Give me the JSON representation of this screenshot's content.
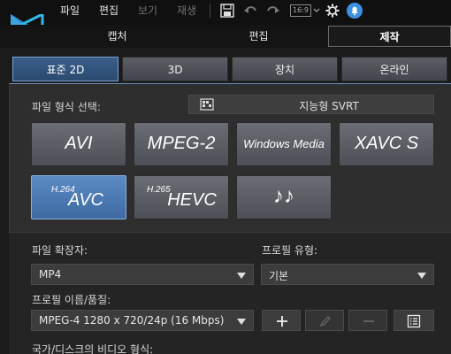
{
  "menu": {
    "items": [
      {
        "label": "파일",
        "enabled": true
      },
      {
        "label": "편집",
        "enabled": true
      },
      {
        "label": "보기",
        "enabled": false
      },
      {
        "label": "재생",
        "enabled": false
      }
    ],
    "aspect_label": "16:9",
    "icons": [
      "save-icon",
      "undo-icon",
      "redo-icon",
      "aspect-ratio-icon",
      "settings-gear-icon",
      "notification-bell-icon"
    ]
  },
  "modes": {
    "tabs": [
      "캡처",
      "편집",
      "제작"
    ],
    "active": "제작"
  },
  "sub_tabs": {
    "tabs": [
      "표준 2D",
      "3D",
      "장치",
      "온라인"
    ],
    "active": "표준 2D"
  },
  "format_section": {
    "label": "파일 형식 선택:",
    "svrt_button": "지능형 SVRT",
    "formats": [
      {
        "name": "AVI",
        "sup": "",
        "selected": false
      },
      {
        "name": "MPEG-2",
        "sup": "",
        "selected": false
      },
      {
        "name": "Windows Media",
        "sup": "",
        "selected": false
      },
      {
        "name": "XAVC S",
        "sup": "",
        "selected": false
      },
      {
        "name": "AVC",
        "sup": "H.264",
        "selected": true
      },
      {
        "name": "HEVC",
        "sup": "H.265",
        "selected": false
      },
      {
        "name": "♪♪",
        "sup": "",
        "selected": false
      }
    ]
  },
  "settings": {
    "extension_label": "파일 확장자:",
    "extension_value": "MP4",
    "profile_type_label": "프로필 유형:",
    "profile_type_value": "기본",
    "profile_name_label": "프로필 이름/품질:",
    "profile_name_value": "MPEG-4 1280 x 720/24p (16 Mbps)",
    "country_label": "국가/디스크의 비디오 형식:"
  },
  "colors": {
    "accent": "#4f7fbf",
    "panel": "#2e2e2e",
    "background": "#1b1b1b"
  }
}
